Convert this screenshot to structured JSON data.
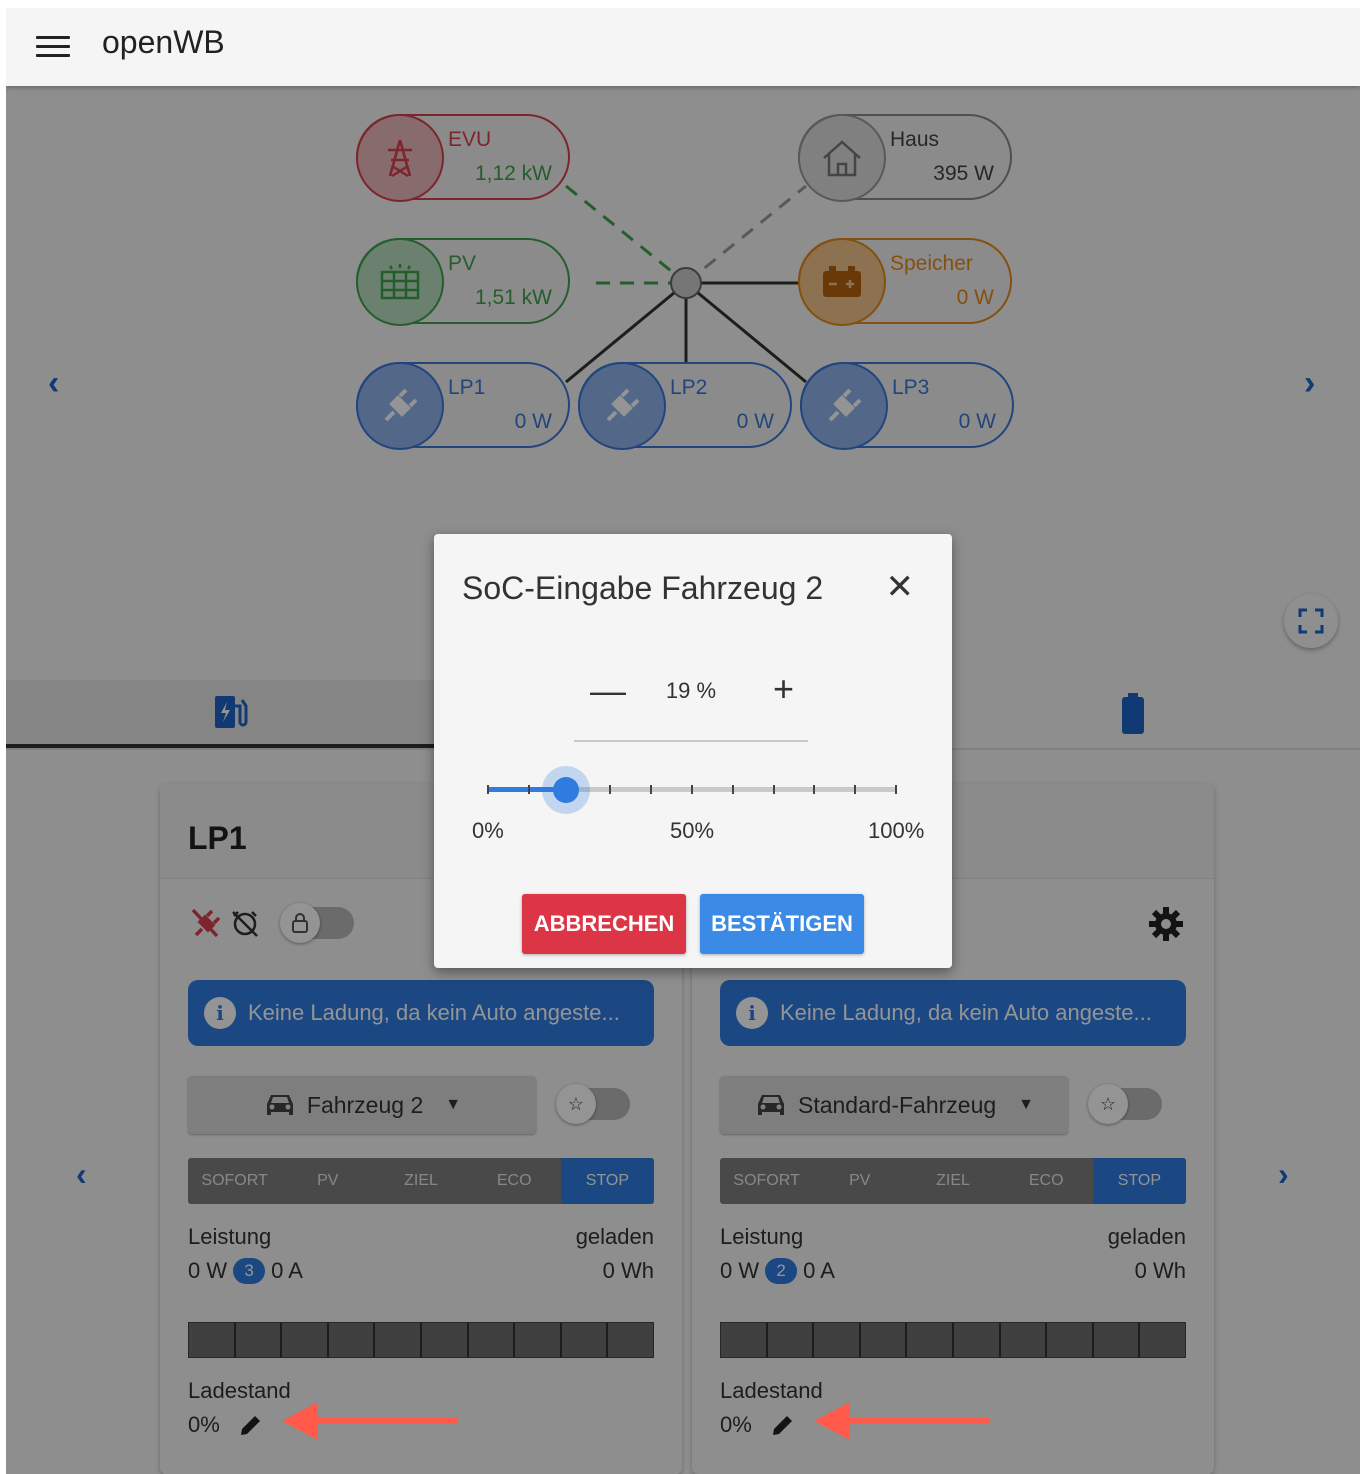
{
  "header": {
    "title": "openWB"
  },
  "diagram": {
    "evu": {
      "label": "EVU",
      "value": "1,12 kW"
    },
    "pv": {
      "label": "PV",
      "value": "1,51 kW"
    },
    "haus": {
      "label": "Haus",
      "value": "395 W"
    },
    "speicher": {
      "label": "Speicher",
      "value": "0 W"
    },
    "lp1": {
      "label": "LP1",
      "value": "0 W"
    },
    "lp2": {
      "label": "LP2",
      "value": "0 W"
    },
    "lp3": {
      "label": "LP3",
      "value": "0 W"
    }
  },
  "cards": [
    {
      "title": "LP1",
      "info": "Keine Ladung, da kein Auto angeste...",
      "vehicle": "Fahrzeug 2",
      "modes": [
        "SOFORT",
        "PV",
        "ZIEL",
        "ECO",
        "STOP"
      ],
      "active_mode": "STOP",
      "power_label": "Leistung",
      "charged_label": "geladen",
      "power_w": "0 W",
      "phases": "3",
      "current": "0 A",
      "charged": "0 Wh",
      "soc_label": "Ladestand",
      "soc_value": "0%"
    },
    {
      "title": "",
      "info": "Keine Ladung, da kein Auto angeste...",
      "vehicle": "Standard-Fahrzeug",
      "modes": [
        "SOFORT",
        "PV",
        "ZIEL",
        "ECO",
        "STOP"
      ],
      "active_mode": "STOP",
      "power_label": "Leistung",
      "charged_label": "geladen",
      "power_w": "0 W",
      "phases": "2",
      "current": "0 A",
      "charged": "0 Wh",
      "soc_label": "Ladestand",
      "soc_value": "0%"
    }
  ],
  "dialog": {
    "title": "SoC-Eingabe Fahrzeug 2",
    "value_text": "19 %",
    "value": 19,
    "slider_min_label": "0%",
    "slider_mid_label": "50%",
    "slider_max_label": "100%",
    "cancel_label": "ABBRECHEN",
    "confirm_label": "BESTÄTIGEN"
  },
  "colors": {
    "evu": "#d8404c",
    "pv": "#3fa34d",
    "speicher": "#e58a1a",
    "lp": "#3b78d8",
    "primary": "#2f7be0",
    "danger": "#dc3545"
  },
  "icons": {
    "menu": "menu-icon",
    "grid": "power-tower-icon",
    "solar": "solar-panel-icon",
    "house": "house-icon",
    "battery": "battery-icon",
    "charge_point": "ev-plug-icon",
    "fullscreen": "fullscreen-icon",
    "edit": "pencil-icon"
  }
}
